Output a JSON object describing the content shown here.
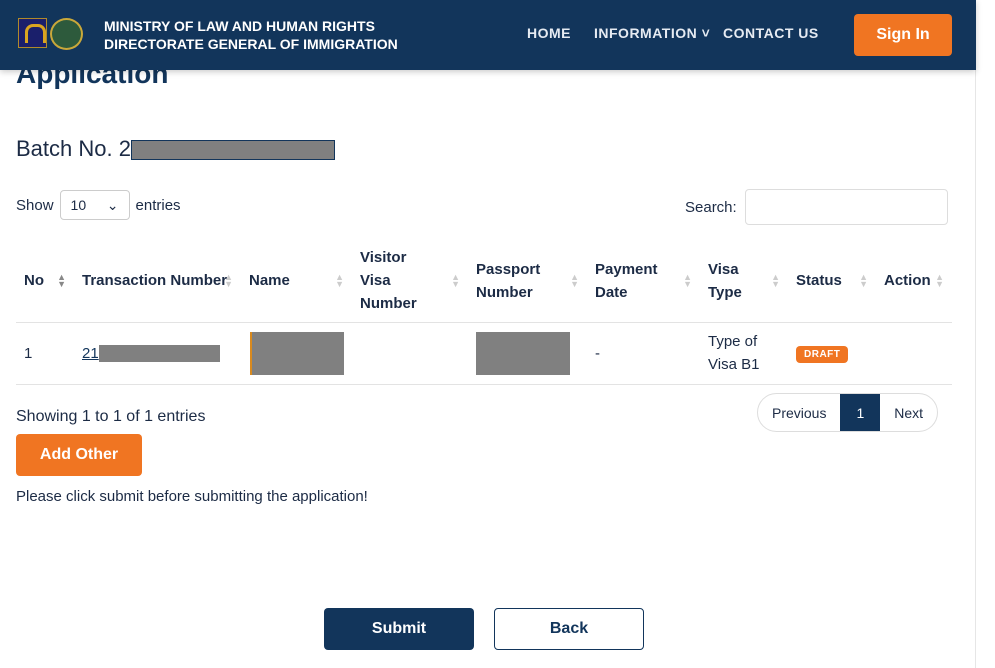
{
  "header": {
    "line1": "MINISTRY OF  LAW  AND HUMAN RIGHTS",
    "line2": "DIRECTORATE GENERAL OF IMMIGRATION",
    "menu": [
      "HOME",
      "INFORMATION",
      "CONTACT US"
    ],
    "sign_in": "Sign In"
  },
  "title": "Application",
  "batch_label": "Batch No. 2",
  "show": {
    "prefix": "Show",
    "value": "10",
    "suffix": "entries"
  },
  "search_label": "Search:",
  "table": {
    "headers": [
      "No",
      "Transaction Number",
      "Name",
      "Visitor Visa Number",
      "Passport Number",
      "Payment Date",
      "Visa Type",
      "Status",
      "Action"
    ],
    "rows": [
      {
        "no": "1",
        "transaction": "21",
        "payment_date": "-",
        "visa_type": "Type of Visa B1",
        "status": "DRAFT"
      }
    ]
  },
  "info": "Showing 1 to 1 of 1 entries",
  "pager": {
    "prev": "Previous",
    "page": "1",
    "next": "Next"
  },
  "add_other": "Add Other",
  "note": "Please click submit before submitting the application!",
  "submit": "Submit",
  "back": "Back",
  "colors": {
    "navy": "#12355b",
    "orange": "#f07522"
  }
}
